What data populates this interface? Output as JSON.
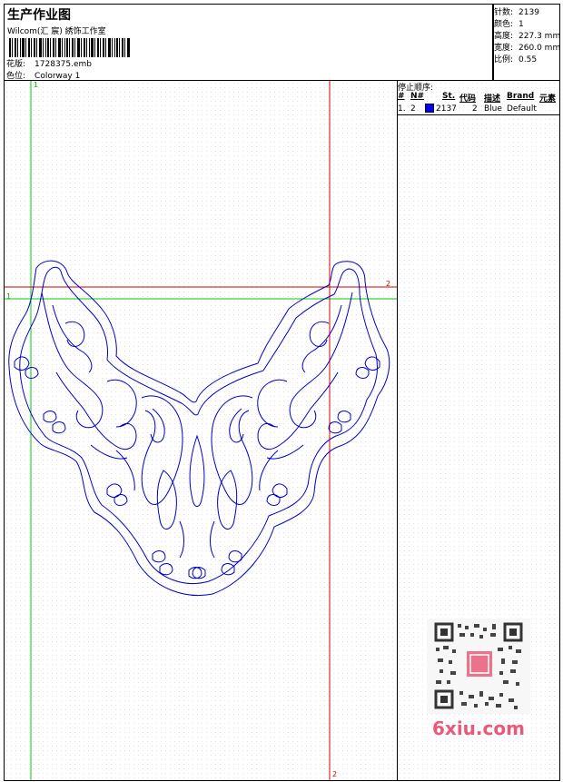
{
  "header": {
    "title": "生产作业图",
    "studio": "Wilcom(汇 宸) 綉饰工作室",
    "pattern_label": "花版:",
    "pattern_value": "1728375.emb",
    "colorway_label": "色位:",
    "colorway_value": "Colorway 1"
  },
  "stats": {
    "stitches_label": "针数:",
    "stitches_value": "2139",
    "colors_label": "颜色:",
    "colors_value": "1",
    "height_label": "高度:",
    "height_value": "227.3 mm",
    "width_label": "宽度:",
    "width_value": "260.0 mm",
    "scale_label": "比例:",
    "scale_value": "0.55"
  },
  "stop_sequence": {
    "title": "停止顺序:",
    "columns": [
      "#",
      "N#",
      "St.",
      "代码",
      "描述",
      "Brand",
      "元素"
    ],
    "rows": [
      {
        "index": "1.",
        "needle": "2",
        "stitches": "2137",
        "code": "2",
        "description": "Blue",
        "brand": "Default",
        "color": "#0000ff"
      }
    ]
  },
  "guides": {
    "v1": "1",
    "h1": "1",
    "h2": "2",
    "v2": "2"
  },
  "colors": {
    "design": "#0000cc",
    "guide_green": "#00cc00",
    "guide_red": "#dd0000",
    "watermark": "#e85a78"
  },
  "watermark": {
    "text": "6xiu.com"
  }
}
